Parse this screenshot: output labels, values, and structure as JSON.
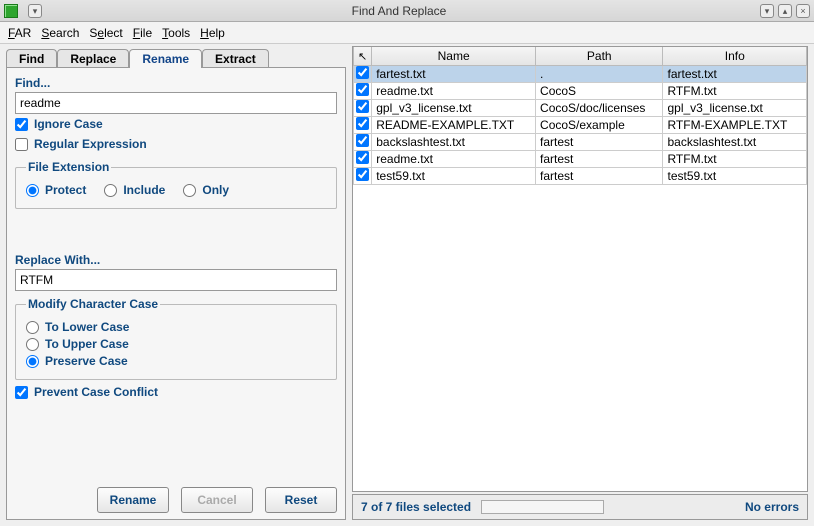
{
  "window": {
    "title": "Find And Replace"
  },
  "menu": {
    "items": [
      {
        "label": "FAR",
        "mn": "F"
      },
      {
        "label": "Search",
        "mn": "S"
      },
      {
        "label": "Select",
        "mn": "e"
      },
      {
        "label": "File",
        "mn": "F"
      },
      {
        "label": "Tools",
        "mn": "T"
      },
      {
        "label": "Help",
        "mn": "H"
      }
    ]
  },
  "tabs": {
    "items": [
      "Find",
      "Replace",
      "Rename",
      "Extract"
    ],
    "active": 2
  },
  "find": {
    "label": "Find...",
    "value": "readme",
    "ignore_case_label": "Ignore Case",
    "ignore_case_checked": true,
    "regex_label": "Regular Expression",
    "regex_checked": false
  },
  "file_ext": {
    "legend": "File Extension",
    "options": [
      "Protect",
      "Include",
      "Only"
    ],
    "selected": 0
  },
  "replace": {
    "label": "Replace With...",
    "value": "RTFM"
  },
  "char_case": {
    "legend": "Modify Character Case",
    "options": [
      "To Lower Case",
      "To Upper Case",
      "Preserve Case"
    ],
    "selected": 2
  },
  "prevent_conflict": {
    "label": "Prevent Case Conflict",
    "checked": true
  },
  "buttons": {
    "rename": "Rename",
    "cancel": "Cancel",
    "reset": "Reset"
  },
  "table": {
    "headers": {
      "name": "Name",
      "path": "Path",
      "info": "Info"
    },
    "rows": [
      {
        "checked": true,
        "selected": true,
        "name": "fartest.txt",
        "path": ".",
        "info": "fartest.txt"
      },
      {
        "checked": true,
        "selected": false,
        "name": "readme.txt",
        "path": "CocoS",
        "info": "RTFM.txt"
      },
      {
        "checked": true,
        "selected": false,
        "name": "gpl_v3_license.txt",
        "path": "CocoS/doc/licenses",
        "info": "gpl_v3_license.txt"
      },
      {
        "checked": true,
        "selected": false,
        "name": "README-EXAMPLE.TXT",
        "path": "CocoS/example",
        "info": "RTFM-EXAMPLE.TXT"
      },
      {
        "checked": true,
        "selected": false,
        "name": "backslashtest.txt",
        "path": "fartest",
        "info": "backslashtest.txt"
      },
      {
        "checked": true,
        "selected": false,
        "name": "readme.txt",
        "path": "fartest",
        "info": "RTFM.txt"
      },
      {
        "checked": true,
        "selected": false,
        "name": "test59.txt",
        "path": "fartest",
        "info": "test59.txt"
      }
    ]
  },
  "status": {
    "selection": "7 of 7 files selected",
    "errors": "No errors"
  }
}
